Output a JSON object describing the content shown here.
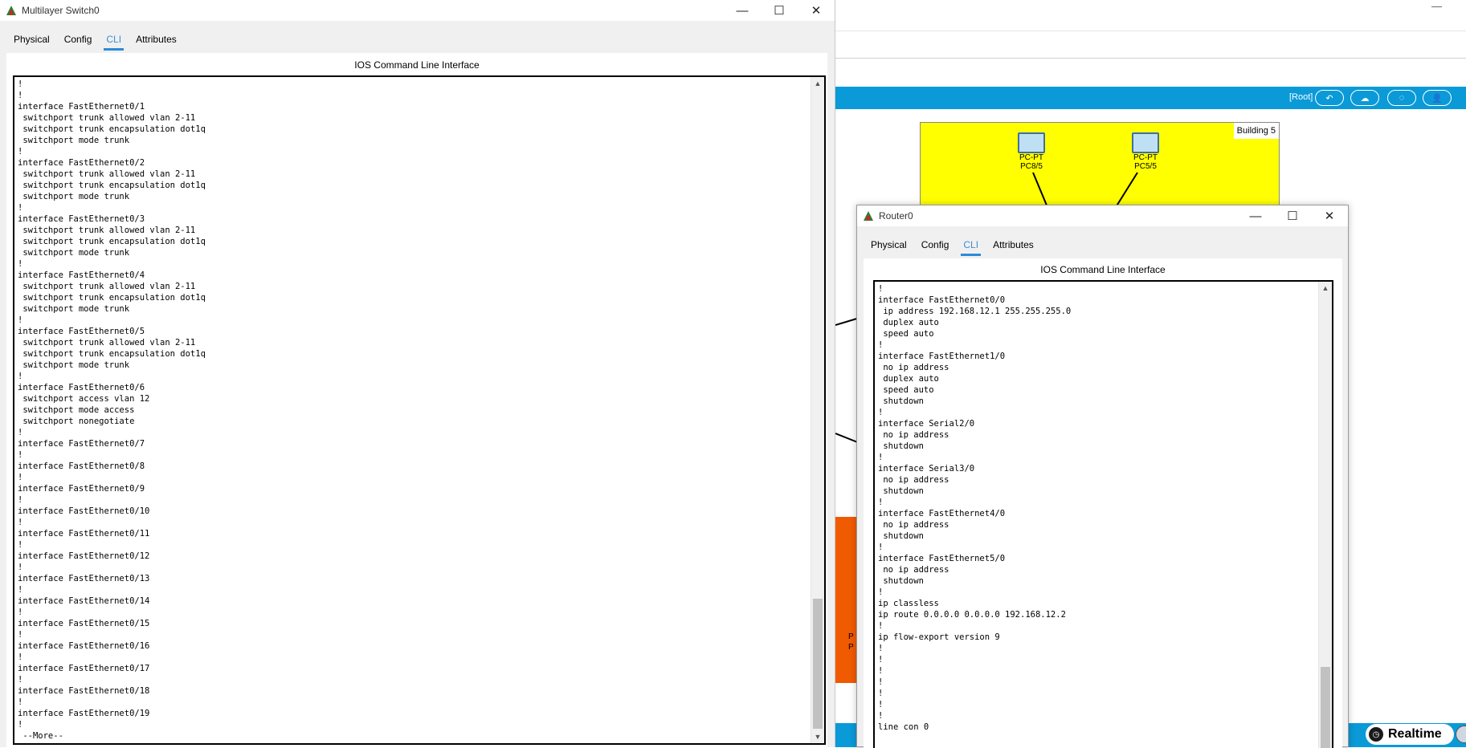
{
  "background_app": {
    "root_label": "[Root]",
    "building_label": "Building 5",
    "pcs": [
      {
        "type": "PC-PT",
        "name": "PC8/5"
      },
      {
        "type": "PC-PT",
        "name": "PC5/5"
      }
    ],
    "partial_labels": [
      "P",
      "P"
    ],
    "realtime_label": "Realtime",
    "colors": {
      "toolbar_blue": "#0a9ad8",
      "building_yellow": "#ffff00",
      "orange_zone": "#f05a00"
    }
  },
  "switch_window": {
    "title": "Multilayer Switch0",
    "tabs": [
      "Physical",
      "Config",
      "CLI",
      "Attributes"
    ],
    "active_tab": "CLI",
    "panel_title": "IOS Command Line Interface",
    "cli_lines": [
      "!",
      "!",
      "interface FastEthernet0/1",
      " switchport trunk allowed vlan 2-11",
      " switchport trunk encapsulation dot1q",
      " switchport mode trunk",
      "!",
      "interface FastEthernet0/2",
      " switchport trunk allowed vlan 2-11",
      " switchport trunk encapsulation dot1q",
      " switchport mode trunk",
      "!",
      "interface FastEthernet0/3",
      " switchport trunk allowed vlan 2-11",
      " switchport trunk encapsulation dot1q",
      " switchport mode trunk",
      "!",
      "interface FastEthernet0/4",
      " switchport trunk allowed vlan 2-11",
      " switchport trunk encapsulation dot1q",
      " switchport mode trunk",
      "!",
      "interface FastEthernet0/5",
      " switchport trunk allowed vlan 2-11",
      " switchport trunk encapsulation dot1q",
      " switchport mode trunk",
      "!",
      "interface FastEthernet0/6",
      " switchport access vlan 12",
      " switchport mode access",
      " switchport nonegotiate",
      "!",
      "interface FastEthernet0/7",
      "!",
      "interface FastEthernet0/8",
      "!",
      "interface FastEthernet0/9",
      "!",
      "interface FastEthernet0/10",
      "!",
      "interface FastEthernet0/11",
      "!",
      "interface FastEthernet0/12",
      "!",
      "interface FastEthernet0/13",
      "!",
      "interface FastEthernet0/14",
      "!",
      "interface FastEthernet0/15",
      "!",
      "interface FastEthernet0/16",
      "!",
      "interface FastEthernet0/17",
      "!",
      "interface FastEthernet0/18",
      "!",
      "interface FastEthernet0/19",
      "!",
      " --More--"
    ]
  },
  "router_window": {
    "title": "Router0",
    "tabs": [
      "Physical",
      "Config",
      "CLI",
      "Attributes"
    ],
    "active_tab": "CLI",
    "panel_title": "IOS Command Line Interface",
    "cli_lines": [
      "!",
      "interface FastEthernet0/0",
      " ip address 192.168.12.1 255.255.255.0",
      " duplex auto",
      " speed auto",
      "!",
      "interface FastEthernet1/0",
      " no ip address",
      " duplex auto",
      " speed auto",
      " shutdown",
      "!",
      "interface Serial2/0",
      " no ip address",
      " shutdown",
      "!",
      "interface Serial3/0",
      " no ip address",
      " shutdown",
      "!",
      "interface FastEthernet4/0",
      " no ip address",
      " shutdown",
      "!",
      "interface FastEthernet5/0",
      " no ip address",
      " shutdown",
      "!",
      "ip classless",
      "ip route 0.0.0.0 0.0.0.0 192.168.12.2",
      "!",
      "ip flow-export version 9",
      "!",
      "!",
      "!",
      "!",
      "!",
      "!",
      "!",
      "line con 0"
    ]
  }
}
